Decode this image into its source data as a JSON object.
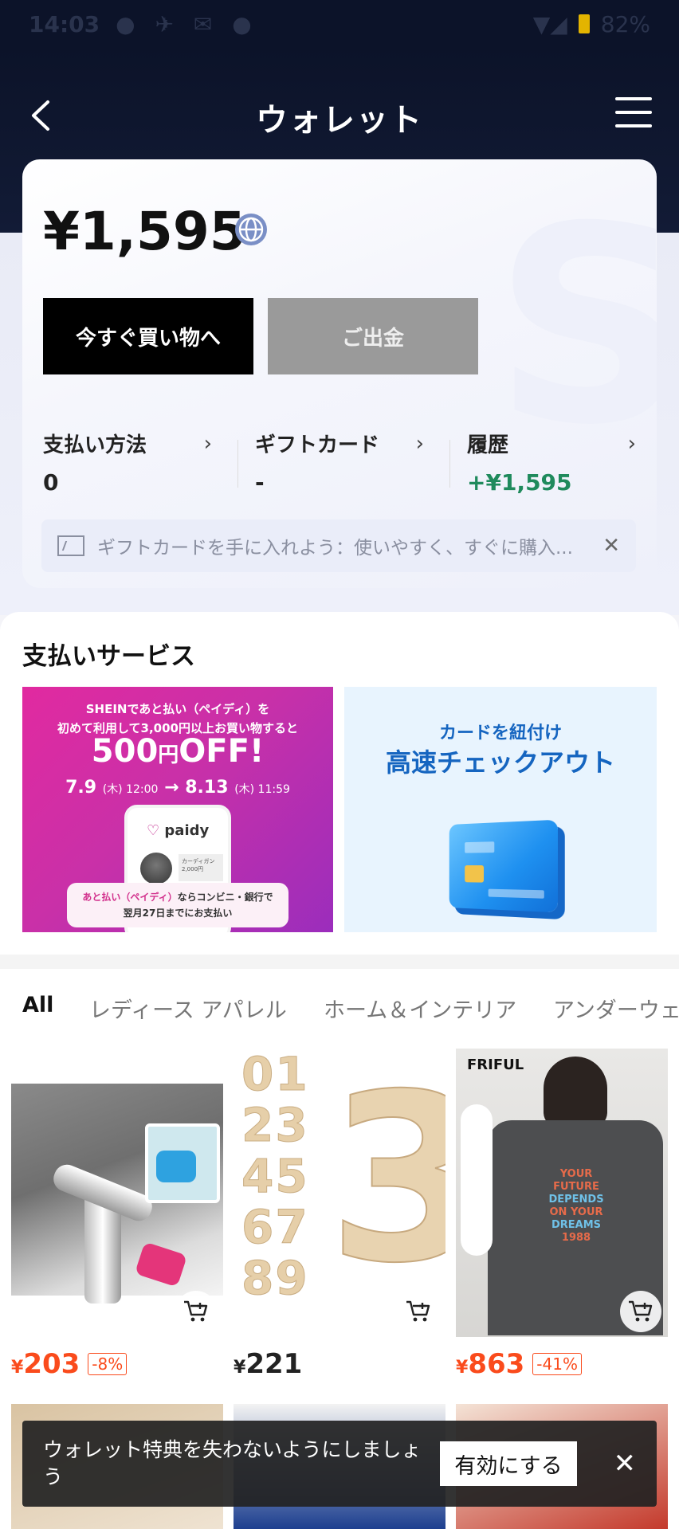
{
  "status_bar": {
    "time": "14:03",
    "battery": "82%"
  },
  "nav": {
    "title": "ウォレット"
  },
  "wallet": {
    "balance": "¥1,595",
    "shop_button": "今すぐ買い物へ",
    "withdraw_button": "ご出金",
    "stats": [
      {
        "label": "支払い方法",
        "value": "0"
      },
      {
        "label": "ギフトカード",
        "value": "-"
      },
      {
        "label": "履歴",
        "value": "+¥1,595"
      }
    ],
    "gift_banner": "ギフトカードを手に入れよう：使いやすく、すぐに購入..."
  },
  "payment": {
    "title": "支払いサービス",
    "paidy": {
      "line1": "SHEINであと払い（ペイディ）を",
      "line2": "初めて利用して3,000円以上お買い物すると",
      "amount": "500",
      "yen": "円",
      "off": "OFF!",
      "date_start": "7.9",
      "date_start_sub": "(木) 12:00",
      "arrow": "→",
      "date_end": "8.13",
      "date_end_sub": "(木) 11:59",
      "logo": "paidy",
      "product_name": "カーディガン",
      "product_price": "2,000円",
      "pill_highlight": "あと払い（ペイディ）",
      "pill_rest": "ならコンビニ・銀行で",
      "pill_line2": "翌月27日までにお支払い"
    },
    "card_link": {
      "line1": "カードを紐付け",
      "line2": "高速チェックアウト"
    }
  },
  "categories": [
    "All",
    "レディース アパレル",
    "ホーム＆インテリア",
    "アンダーウェ"
  ],
  "products": [
    {
      "price": "203",
      "discount": "-8%"
    },
    {
      "price": "221",
      "discount": ""
    },
    {
      "price": "863",
      "discount": "-41%",
      "brand": "FRIFUL"
    }
  ],
  "currency_symbol": "¥",
  "product_print": {
    "l1": "YOUR",
    "l2": "FUTURE",
    "l3": "DEPENDS",
    "l4": "ON YOUR",
    "l5": "DREAMS",
    "l6": "1988"
  },
  "toast": {
    "message": "ウォレット特典を失わないようにしましょう",
    "button": "有効にする"
  },
  "colors": {
    "accent_price": "#fa4b1c",
    "history_green": "#1f8a5c",
    "header_bg": "#0c1329"
  }
}
